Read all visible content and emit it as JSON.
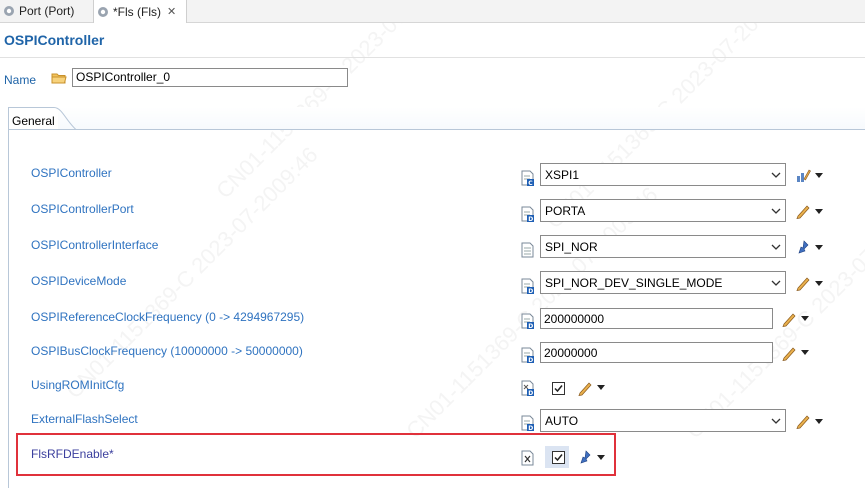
{
  "tabs": [
    {
      "label": "Port (Port)",
      "icon": "module-icon"
    },
    {
      "label": "*Fls (Fls)",
      "icon": "module-icon",
      "close": "✕"
    }
  ],
  "title": "OSPIController",
  "name_label": "Name",
  "name_value": "OSPIController_0",
  "section_tab": "General",
  "params": [
    {
      "label": "OSPIController",
      "control": "combo",
      "value": "XSPI1",
      "action_icon": "chart-edit-icon",
      "icon": "c-doc-icon"
    },
    {
      "label": "OSPIControllerPort",
      "control": "combo",
      "value": "PORTA",
      "action_icon": "pencil-icon",
      "icon": "d-doc-icon"
    },
    {
      "label": "OSPIControllerInterface",
      "control": "combo",
      "value": "SPI_NOR",
      "action_icon": "chain-icon",
      "icon": "doc-icon"
    },
    {
      "label": "OSPIDeviceMode",
      "control": "combo",
      "value": "SPI_NOR_DEV_SINGLE_MODE",
      "action_icon": "pencil-icon",
      "icon": "d-doc-icon"
    },
    {
      "label": "OSPIReferenceClockFrequency (0 -> 4294967295)",
      "control": "text",
      "value": "200000000",
      "action_icon": "pencil-icon",
      "icon": "d-doc-icon"
    },
    {
      "label": "OSPIBusClockFrequency (10000000 -> 50000000)",
      "control": "text",
      "value": "20000000",
      "action_icon": "pencil-icon",
      "icon": "d-doc-icon"
    },
    {
      "label": "UsingROMInitCfg",
      "control": "checkbox",
      "checked": true,
      "action_icon": "pencil-icon",
      "icon": "x-doc-icon"
    },
    {
      "label": "ExternalFlashSelect",
      "control": "combo",
      "value": "AUTO",
      "action_icon": "pencil-icon",
      "icon": "d-doc-icon"
    },
    {
      "label": "FlsRFDEnable*",
      "control": "checkbox",
      "checked": true,
      "action_icon": "chain-icon",
      "icon": "x-doc-icon"
    }
  ],
  "watermark": "CN01-1151369-C 2023-07-2009:46",
  "colors": {
    "accent": "#1f64a8",
    "label": "#2f73c0",
    "highlight": "#e0313b"
  }
}
